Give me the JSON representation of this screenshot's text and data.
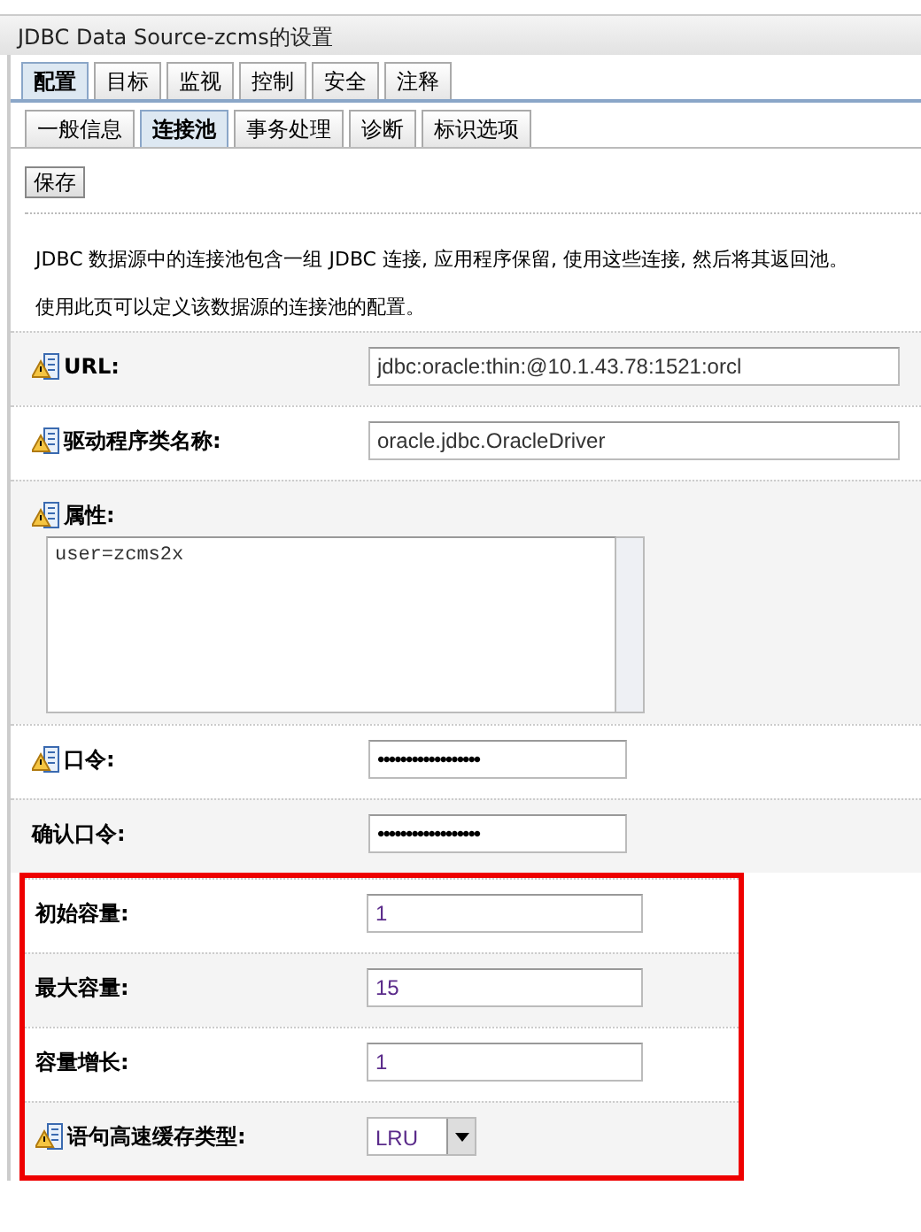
{
  "window": {
    "title": "JDBC Data Source-zcms的设置"
  },
  "tabs": [
    {
      "label": "配置",
      "selected": true
    },
    {
      "label": "目标",
      "selected": false
    },
    {
      "label": "监视",
      "selected": false
    },
    {
      "label": "控制",
      "selected": false
    },
    {
      "label": "安全",
      "selected": false
    },
    {
      "label": "注释",
      "selected": false
    }
  ],
  "subtabs": [
    {
      "label": "一般信息",
      "selected": false
    },
    {
      "label": "连接池",
      "selected": true
    },
    {
      "label": "事务处理",
      "selected": false
    },
    {
      "label": "诊断",
      "selected": false
    },
    {
      "label": "标识选项",
      "selected": false
    }
  ],
  "save_button": "保存",
  "description": [
    "JDBC 数据源中的连接池包含一组 JDBC 连接, 应用程序保留, 使用这些连接, 然后将其返回池。",
    "使用此页可以定义该数据源的连接池的配置。"
  ],
  "fields": [
    {
      "kind": "text",
      "label": "URL:",
      "value": "jdbc:oracle:thin:@10.1.43.78:1521:orcl",
      "warning": true,
      "highlighted": false
    },
    {
      "kind": "text",
      "label": "驱动程序类名称:",
      "value": "oracle.jdbc.OracleDriver",
      "warning": true,
      "highlighted": false
    },
    {
      "kind": "textarea",
      "label": "属性:",
      "value": "user=zcms2x",
      "warning": true,
      "highlighted": false
    },
    {
      "kind": "password",
      "label": "口令:",
      "value": "••••••••••••••••••",
      "warning": true,
      "highlighted": false
    },
    {
      "kind": "password",
      "label": "确认口令:",
      "value": "••••••••••••••••••",
      "warning": false,
      "highlighted": false
    },
    {
      "kind": "number",
      "label": "初始容量:",
      "value": "1",
      "warning": false,
      "highlighted": true
    },
    {
      "kind": "number",
      "label": "最大容量:",
      "value": "15",
      "warning": false,
      "highlighted": true
    },
    {
      "kind": "number",
      "label": "容量增长:",
      "value": "1",
      "warning": false,
      "highlighted": true
    },
    {
      "kind": "select",
      "label": "语句高速缓存类型:",
      "value": "LRU",
      "warning": true,
      "highlighted": true
    }
  ]
}
